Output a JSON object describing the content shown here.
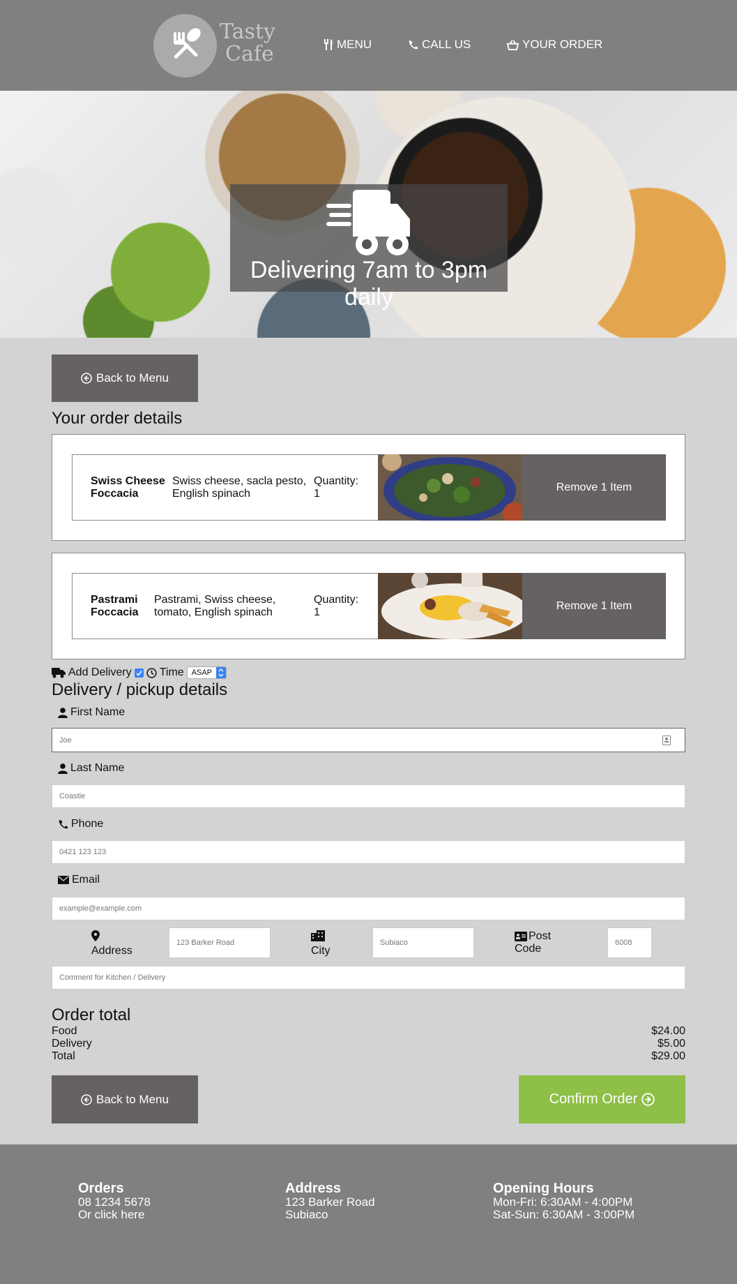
{
  "header": {
    "logo_line1": "Tasty",
    "logo_line2": "Cafe",
    "nav": {
      "menu": "MENU",
      "call": "CALL US",
      "order": "YOUR ORDER"
    }
  },
  "hero": {
    "text": "Delivering 7am to 3pm daily"
  },
  "back_button": "Back to Menu",
  "order_title": "Your order details",
  "orders": [
    {
      "name_line1": "Swiss Cheese",
      "name_line2": "Foccacia",
      "desc_line1": "Swiss cheese, sacla pesto,",
      "desc_line2": "English spinach",
      "qty_label": "Quantity:",
      "qty": "1",
      "remove": "Remove 1 Item"
    },
    {
      "name_line1": "Pastrami",
      "name_line2": "Foccacia",
      "desc_line1": "Pastrami, Swiss cheese,",
      "desc_line2": "tomato, English spinach",
      "qty_label": "Quantity:",
      "qty": "1",
      "remove": "Remove 1 Item"
    }
  ],
  "delivery_options": {
    "add_delivery": "Add Delivery",
    "time_label": "Time",
    "time_value": "ASAP"
  },
  "details_title": "Delivery / pickup details",
  "form": {
    "first_name_label": "First Name",
    "first_name_placeholder": "Joe",
    "last_name_label": "Last Name",
    "last_name_placeholder": "Coastie",
    "phone_label": "Phone",
    "phone_placeholder": "0421 123 123",
    "email_label": "Email",
    "email_placeholder": "example@example.com",
    "address_label": "Address",
    "address_placeholder": "123 Barker Road",
    "city_label": "City",
    "city_placeholder": "Subiaco",
    "postcode_label_line1": "Post",
    "postcode_label_line2": "Code",
    "postcode_placeholder": "6008",
    "comment_placeholder": "Comment for Kitchen / Delivery"
  },
  "totals": {
    "title": "Order total",
    "food_label": "Food",
    "food_value": "$24.00",
    "delivery_label": "Delivery",
    "delivery_value": "$5.00",
    "total_label": "Total",
    "total_value": "$29.00"
  },
  "confirm_button": "Confirm Order",
  "footer": {
    "orders_title": "Orders",
    "orders_phone": "08 1234 5678",
    "orders_link": "Or click here",
    "address_title": "Address",
    "address_line1": "123 Barker Road",
    "address_line2": "Subiaco",
    "hours_title": "Opening Hours",
    "hours_line1": "Mon-Fri: 6:30AM - 4:00PM",
    "hours_line2": "Sat-Sun: 6:30AM - 3:00PM"
  },
  "colors": {
    "header_bg": "#808080",
    "page_bg": "#d3d3d3",
    "button_dark": "#666262",
    "button_green": "#8ebf47"
  }
}
